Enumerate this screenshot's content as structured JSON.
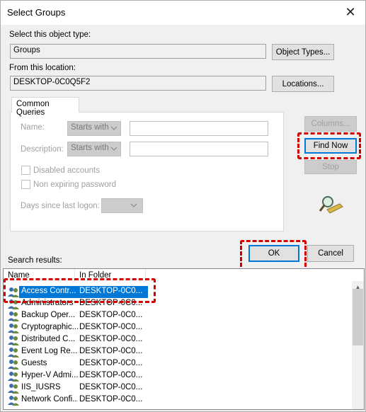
{
  "window": {
    "title": "Select Groups"
  },
  "object_type": {
    "label": "Select this object type:",
    "value": "Groups",
    "button": "Object Types..."
  },
  "location": {
    "label": "From this location:",
    "value": "DESKTOP-0C0Q5F2",
    "button": "Locations..."
  },
  "common_queries": {
    "tab_label": "Common Queries",
    "name_label": "Name:",
    "name_mode": "Starts with",
    "description_label": "Description:",
    "description_mode": "Starts with",
    "disabled_accounts": "Disabled accounts",
    "non_expiring_password": "Non expiring password",
    "days_since_logon": "Days since last logon:"
  },
  "side_buttons": {
    "columns": "Columns...",
    "find_now": "Find Now",
    "stop": "Stop"
  },
  "ok_button": "OK",
  "cancel_button": "Cancel",
  "results": {
    "label": "Search results:",
    "columns": [
      "Name",
      "In Folder"
    ],
    "rows": [
      {
        "name": "Access Contr...",
        "folder": "DESKTOP-0C0..."
      },
      {
        "name": "Administrators",
        "folder": "DESKTOP-0C0..."
      },
      {
        "name": "Backup Oper...",
        "folder": "DESKTOP-0C0..."
      },
      {
        "name": "Cryptographic...",
        "folder": "DESKTOP-0C0..."
      },
      {
        "name": "Distributed C...",
        "folder": "DESKTOP-0C0..."
      },
      {
        "name": "Event Log Re...",
        "folder": "DESKTOP-0C0..."
      },
      {
        "name": "Guests",
        "folder": "DESKTOP-0C0..."
      },
      {
        "name": "Hyper-V Admi...",
        "folder": "DESKTOP-0C0..."
      },
      {
        "name": "IIS_IUSRS",
        "folder": "DESKTOP-0C0..."
      },
      {
        "name": "Network Confi...",
        "folder": "DESKTOP-0C0..."
      }
    ]
  },
  "colors": {
    "selection": "#0078d7",
    "highlight_dash": "#d40000"
  }
}
